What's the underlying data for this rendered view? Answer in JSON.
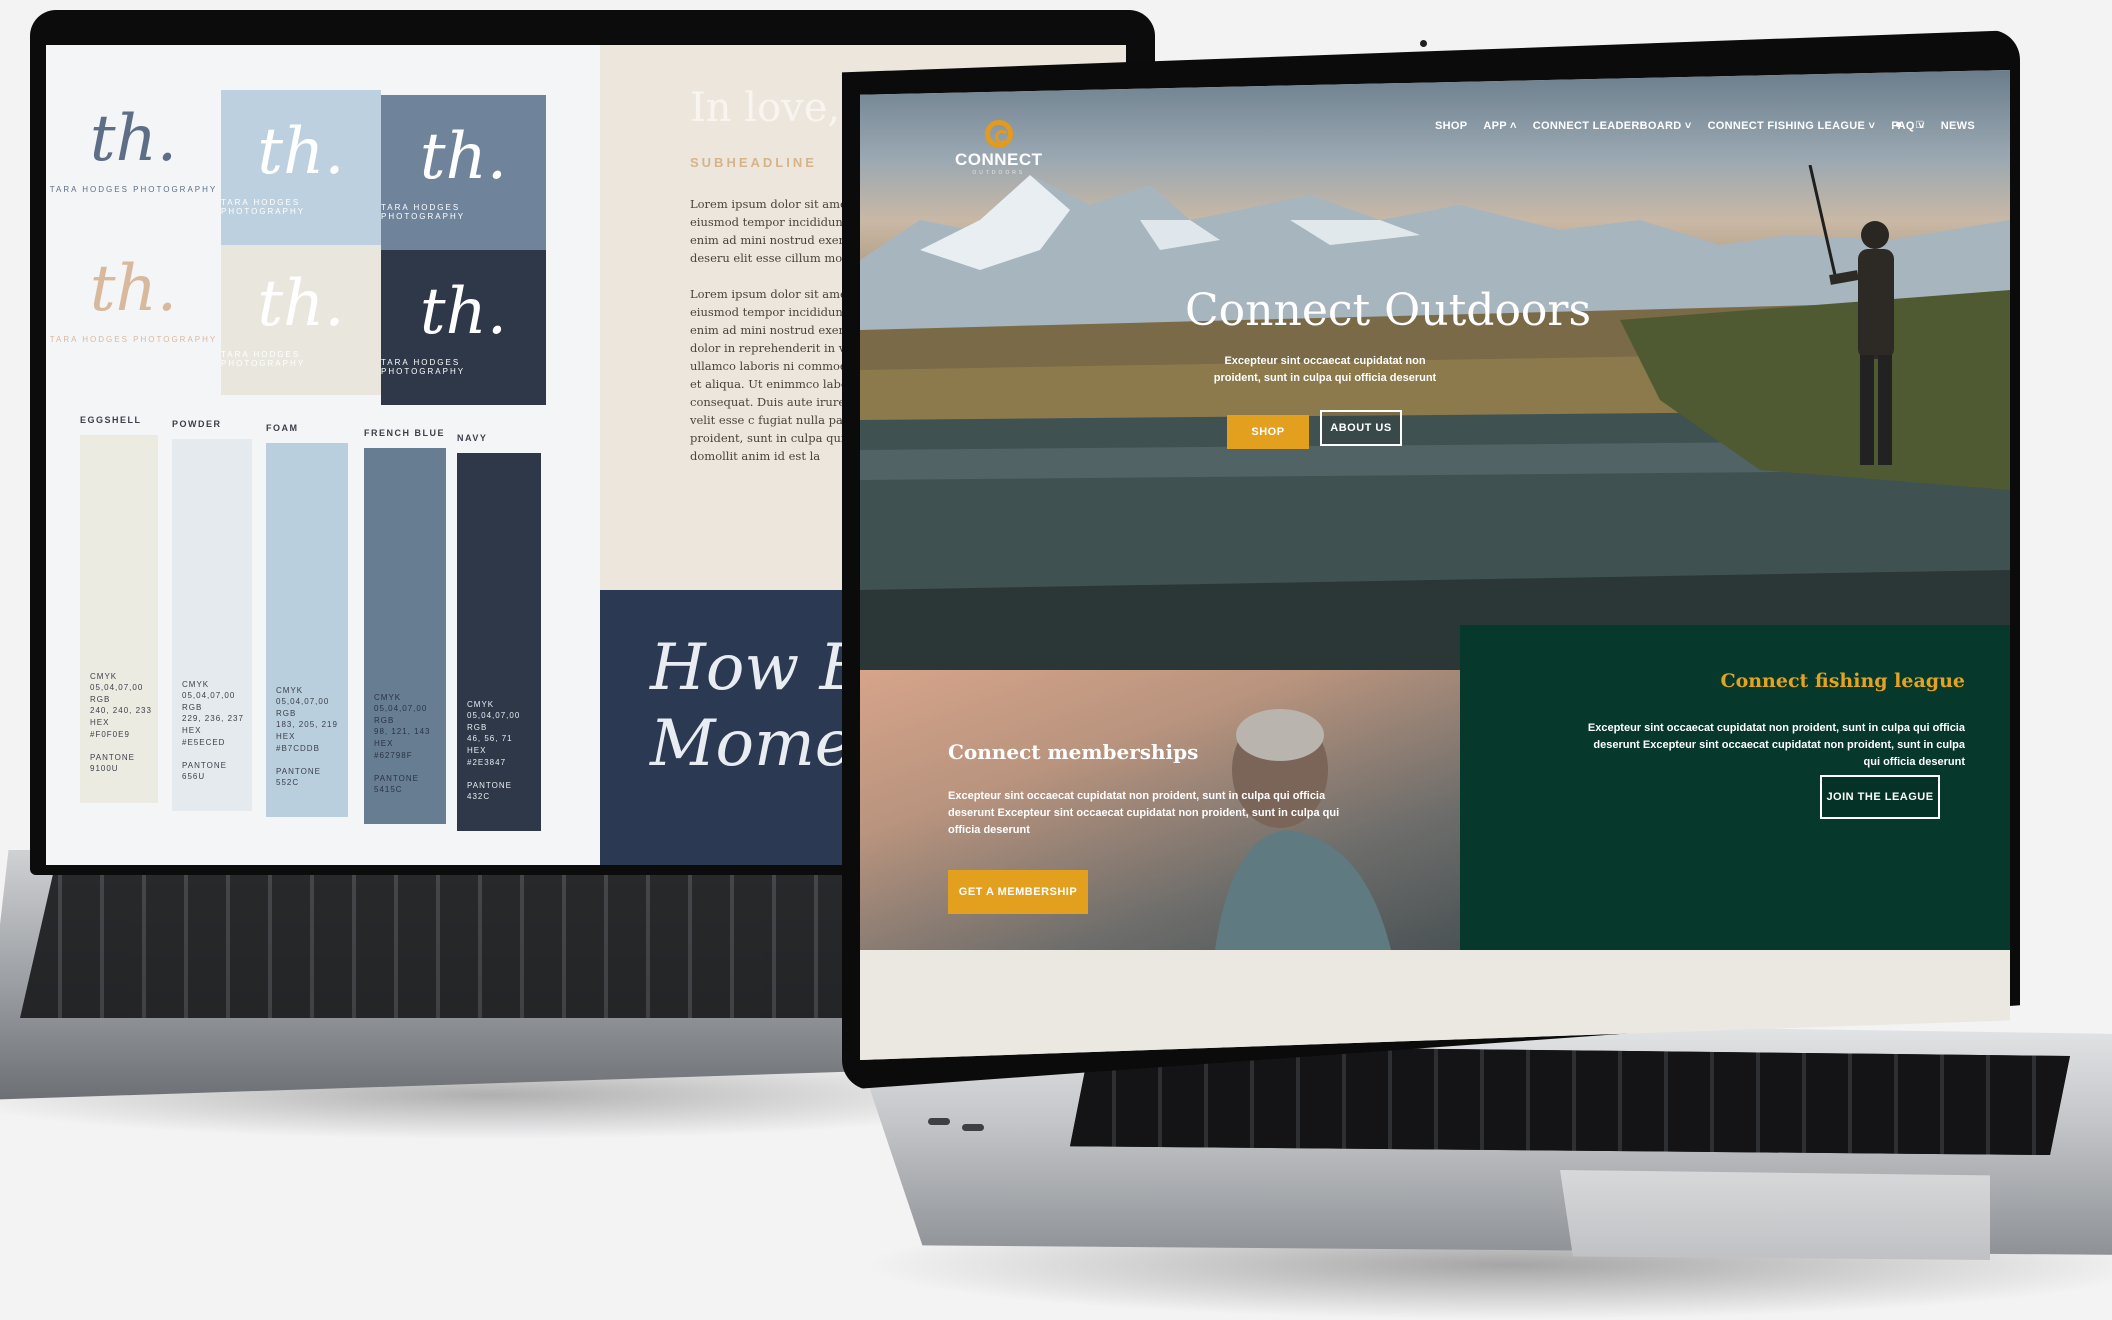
{
  "left_screen": {
    "logo_caption": "TARA HODGES PHOTOGRAPHY",
    "logo_mark": "th.",
    "swatches": [
      {
        "name": "EGGSHELL",
        "spec": "CMYK\n05,04,07,00\nRGB\n240, 240, 233\nHEX\n#F0F0E9\n\nPANTONE\n9100U",
        "color": "#ecebe2",
        "text_color": "#3b3f49"
      },
      {
        "name": "POWDER",
        "spec": "CMYK\n05,04,07,00\nRGB\n229, 236, 237\nHEX\n#E5ECED\n\nPANTONE\n656U",
        "color": "#e5eaee",
        "text_color": "#3b3f49"
      },
      {
        "name": "FOAM",
        "spec": "CMYK\n05,04,07,00\nRGB\n183, 205, 219\nHEX\n#B7CDDB\n\nPANTONE\n552C",
        "color": "#b9cfdd",
        "text_color": "#3b3f49"
      },
      {
        "name": "FRENCH BLUE",
        "spec": "CMYK\n05,04,07,00\nRGB\n98, 121, 143\nHEX\n#62798F\n\nPANTONE\n5415C",
        "color": "#677d92",
        "text_color": "#2a3345"
      },
      {
        "name": "NAVY",
        "spec": "CMYK\n05,04,07,00\nRGB\n46, 56, 71\nHEX\n#2E3847\n\nPANTONE\n432C",
        "color": "#2e3848",
        "text_color": "#e8ecf2"
      }
    ],
    "doc": {
      "title": "In love, with",
      "subheadline": "SUBHEADLINE",
      "paragraphs": [
        "Lorem ipsum dolor sit amet, consecte elit, sed do eiusmod tempor incididun dolore magna aliqua. Ut enim ad mini nostrud exercitationem, sunt in culp deseru elit esse cillum mollit anim id e",
        "Lorem ipsum dolor sit amet, consecte elit, sed do eiusmod tempor incididun dolore magna aliqua. Ut enim ad mini nostrud exercit ex commodo consequ dolor in reprehenderit in volupta cillum doloreation ullamco laboris ni commod tempor incididunt ut labore et aliqua. Ut enimmco laboris nisi ut aliq commodo consequat. Duis aute irure d reprehenderit in voluptate velit esse c fugiat nulla pariatur. Excepteur sint oc non proident, sunt in culpa qui officia velit esse cillum domollit anim id est la"
      ],
      "quote": "How Eve\nMoment F"
    }
  },
  "right_screen": {
    "brand": {
      "name": "CONNECT",
      "tagline": "OUTDOORS"
    },
    "nav": [
      {
        "label": "SHOP"
      },
      {
        "label": "APP ˄"
      },
      {
        "label": "CONNECT LEADERBOARD ˅"
      },
      {
        "label": "CONNECT FISHING LEAGUE ˅"
      },
      {
        "label": "FAQ ˅"
      },
      {
        "label": "NEWS"
      }
    ],
    "icons": {
      "user": "user-icon",
      "cart": "cart-icon"
    },
    "hero": {
      "title": "Connect Outdoors",
      "description": "Excepteur sint occaecat cupidatat non proident, sunt in culpa qui officia deserunt",
      "shop_label": "SHOP",
      "about_label": "ABOUT US"
    },
    "memberships": {
      "title": "Connect memberships",
      "description": "Excepteur sint occaecat cupidatat non proident, sunt in culpa qui officia deserunt Excepteur sint occaecat cupidatat non proident, sunt in culpa qui officia deserunt",
      "button": "GET A MEMBERSHIP"
    },
    "league": {
      "title": "Connect fishing league",
      "description": "Excepteur sint occaecat cupidatat non proident, sunt in culpa qui officia deserunt Excepteur sint occaecat cupidatat non proident, sunt in culpa qui officia deserunt",
      "button": "JOIN THE LEAGUE"
    },
    "colors": {
      "gold": "#e2a01e",
      "league_green": "#06382b"
    }
  }
}
